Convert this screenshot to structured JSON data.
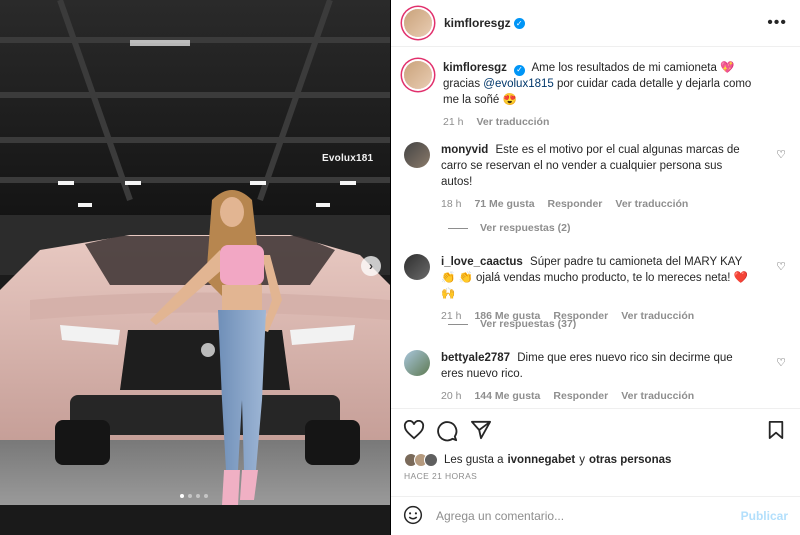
{
  "post": {
    "username": "kimfloresgz",
    "watermark": "Evolux181",
    "carousel_next": "›",
    "caption_text": "Ame los resultados de mi camioneta 💖 gracias",
    "caption_mention": "@evolux1815",
    "caption_text_2": "por cuidar cada detalle y dejarla como me la soñé 😍",
    "caption_time": "21 h",
    "caption_translate": "Ver traducción"
  },
  "comments": [
    {
      "username": "monyvid",
      "text": "Este es el motivo por el cual algunas marcas de carro se reservan el no vender a cualquier persona sus autos!",
      "time": "18 h",
      "likes": "71 Me gusta",
      "reply": "Responder",
      "translate": "Ver traducción",
      "replies": "Ver respuestas (2)"
    },
    {
      "username": "i_love_caactus",
      "text": "Súper padre tu camioneta del MARY KAY 👏 👏 ojalá vendas mucho producto, te lo mereces neta! ❤️🙌",
      "time": "21 h",
      "likes": "186 Me gusta",
      "reply": "Responder",
      "translate": "Ver traducción",
      "replies": "Ver respuestas (37)"
    },
    {
      "username": "bettyale2787",
      "text": "Dime que eres nuevo rico sin decirme que eres nuevo rico.",
      "time": "20 h",
      "likes": "144 Me gusta",
      "reply": "Responder",
      "translate": "Ver traducción"
    }
  ],
  "likes_line": {
    "prefix": "Les gusta a",
    "user": "ivonnegabet",
    "middle": "y",
    "others": "otras personas"
  },
  "timestamp": "HACE 21 HORAS",
  "add_comment": {
    "placeholder": "Agrega un comentario...",
    "post_label": "Publicar"
  },
  "icons": {
    "more": "more-options-icon",
    "like": "heart-icon",
    "comment": "comment-icon",
    "share": "share-icon",
    "save": "bookmark-icon",
    "emoji": "emoji-icon"
  },
  "colors": {
    "verified": "#0095f6",
    "link": "#00376b",
    "muted": "#8e8e8e",
    "publish_disabled": "#b2dffc",
    "car": "#d7b3ac"
  }
}
